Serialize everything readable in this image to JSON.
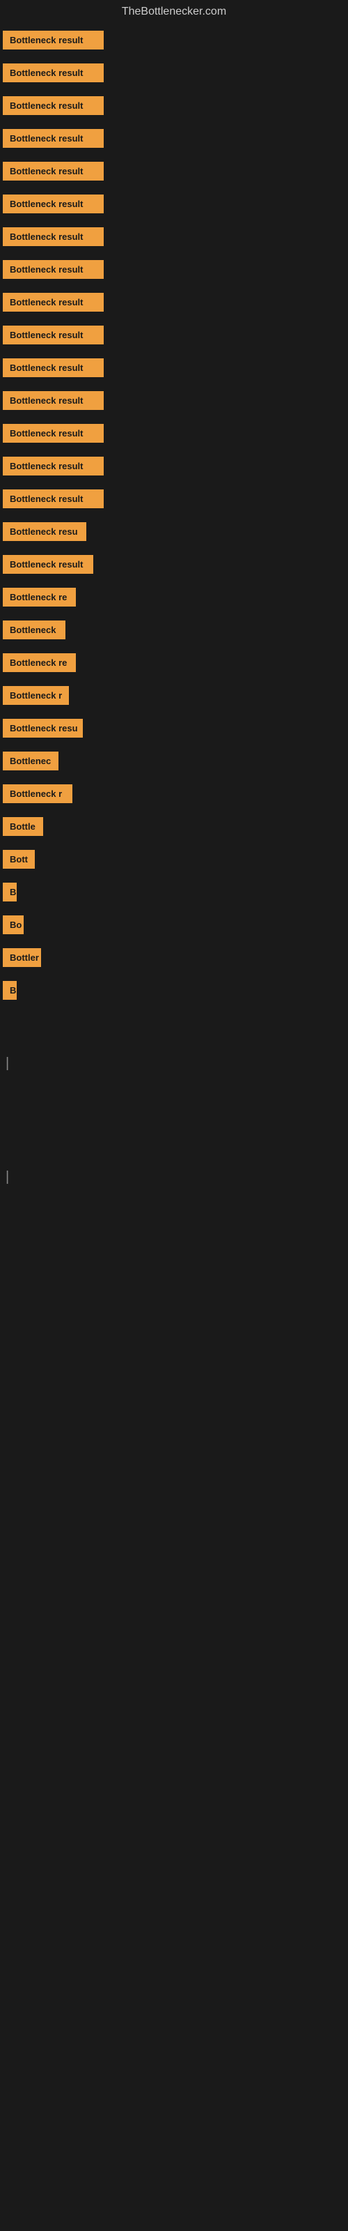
{
  "site": {
    "title": "TheBottlenecker.com"
  },
  "rows": [
    {
      "label": "Bottleneck result",
      "width": 145
    },
    {
      "label": "Bottleneck result",
      "width": 145
    },
    {
      "label": "Bottleneck result",
      "width": 145
    },
    {
      "label": "Bottleneck result",
      "width": 145
    },
    {
      "label": "Bottleneck result",
      "width": 145
    },
    {
      "label": "Bottleneck result",
      "width": 145
    },
    {
      "label": "Bottleneck result",
      "width": 145
    },
    {
      "label": "Bottleneck result",
      "width": 145
    },
    {
      "label": "Bottleneck result",
      "width": 145
    },
    {
      "label": "Bottleneck result",
      "width": 145
    },
    {
      "label": "Bottleneck result",
      "width": 145
    },
    {
      "label": "Bottleneck result",
      "width": 145
    },
    {
      "label": "Bottleneck result",
      "width": 145
    },
    {
      "label": "Bottleneck result",
      "width": 145
    },
    {
      "label": "Bottleneck result",
      "width": 145
    },
    {
      "label": "Bottleneck resu",
      "width": 120
    },
    {
      "label": "Bottleneck result",
      "width": 130
    },
    {
      "label": "Bottleneck re",
      "width": 105
    },
    {
      "label": "Bottleneck",
      "width": 90
    },
    {
      "label": "Bottleneck re",
      "width": 105
    },
    {
      "label": "Bottleneck r",
      "width": 95
    },
    {
      "label": "Bottleneck resu",
      "width": 115
    },
    {
      "label": "Bottlenec",
      "width": 80
    },
    {
      "label": "Bottleneck r",
      "width": 100
    },
    {
      "label": "Bottle",
      "width": 58
    },
    {
      "label": "Bott",
      "width": 46
    },
    {
      "label": "B",
      "width": 20
    },
    {
      "label": "Bo",
      "width": 30
    },
    {
      "label": "Bottler",
      "width": 55
    },
    {
      "label": "B",
      "width": 18
    },
    {
      "label": "",
      "width": 0
    },
    {
      "label": "",
      "width": 0
    },
    {
      "label": "|",
      "width": 10
    },
    {
      "label": "",
      "width": 0
    },
    {
      "label": "",
      "width": 0
    },
    {
      "label": "",
      "width": 0
    },
    {
      "label": "",
      "width": 0
    },
    {
      "label": "|",
      "width": 10
    }
  ]
}
